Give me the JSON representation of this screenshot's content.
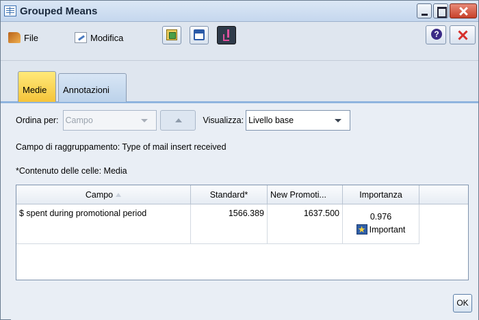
{
  "window": {
    "title": "Grouped Means"
  },
  "menu": {
    "file_label": "File",
    "edit_label": "Modifica"
  },
  "tabs": [
    {
      "label": "Medie",
      "active": true
    },
    {
      "label": "Annotazioni",
      "active": false
    }
  ],
  "controls": {
    "sort_label": "Ordina per:",
    "sort_value": "Campo",
    "view_label": "Visualizza:",
    "view_value": "Livello base"
  },
  "info": {
    "grouping_field": "Campo di raggruppamento: Type of mail insert received",
    "cell_contents": "*Contenuto delle celle: Media"
  },
  "table": {
    "headers": {
      "campo": "Campo",
      "standard": "Standard*",
      "new_promo": "New Promoti...",
      "importance": "Importanza"
    },
    "rows": [
      {
        "campo": "$ spent during promotional period",
        "standard": "1566.389",
        "new_promo": "1637.500",
        "importance_value": "0.976",
        "importance_label": "Important"
      }
    ]
  },
  "footer": {
    "ok_label": "OK"
  },
  "colors": {
    "active_tab": "#f5c43a",
    "accent_border": "#8fb4de",
    "close_red": "#c7412a"
  }
}
